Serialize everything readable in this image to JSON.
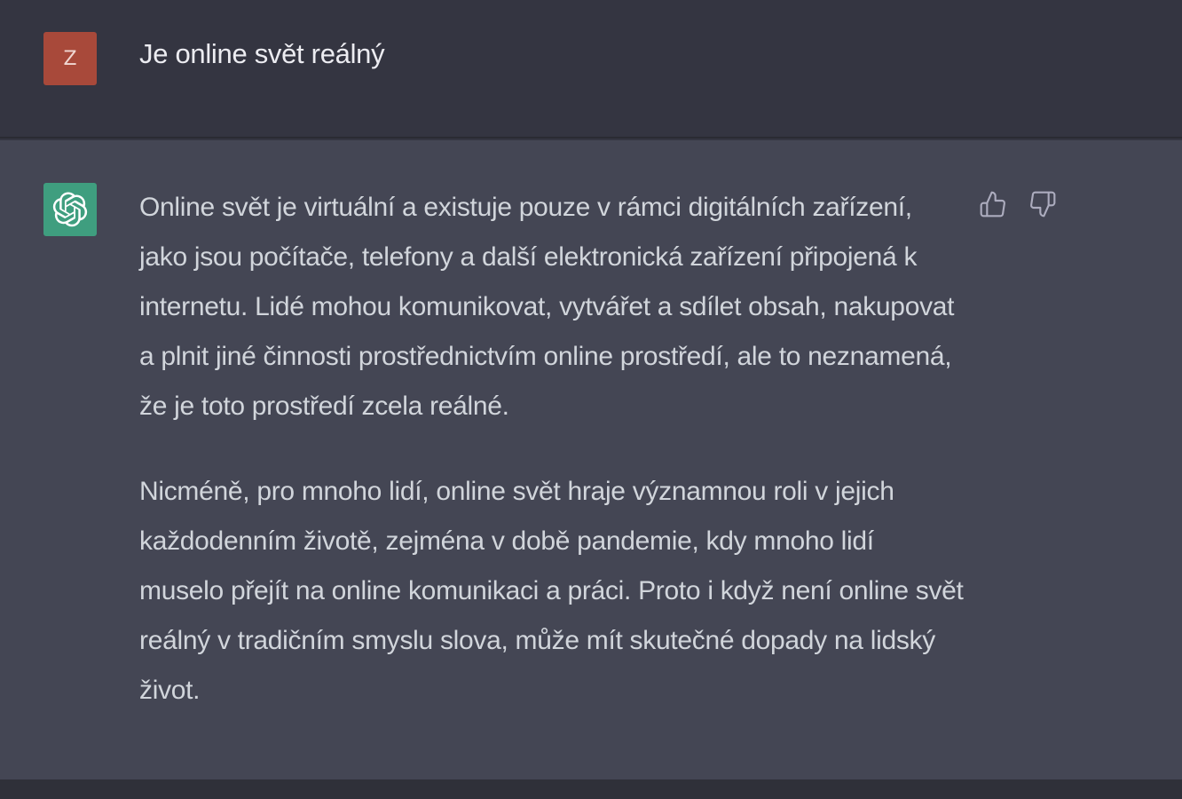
{
  "user_message": {
    "avatar_letter": "Z",
    "avatar_color": "#a8493a",
    "text": "Je online svět reálný"
  },
  "assistant_message": {
    "avatar_icon": "openai-logo-icon",
    "avatar_color": "#3f9e7f",
    "paragraphs": [
      "Online svět je virtuální a existuje pouze v rámci digitálních zařízení, jako jsou počítače, telefony a další elektronická zařízení připojená k internetu. Lidé mohou komunikovat, vytvářet a sdílet obsah, nakupovat a plnit jiné činnosti prostřednictvím online prostředí, ale to neznamená, že je toto prostředí zcela reálné.",
      "Nicméně, pro mnoho lidí, online svět hraje významnou roli v jejich každodenním životě, zejména v době pandemie, kdy mnoho lidí muselo přejít na online komunikaci a práci. Proto i když není online svět reálný v tradičním smyslu slova, může mít skutečné dopady na lidský život."
    ],
    "feedback": {
      "thumbs_up_icon": "thumbs-up-icon",
      "thumbs_down_icon": "thumbs-down-icon"
    }
  },
  "colors": {
    "background_user": "#343541",
    "background_assistant": "#444654",
    "text_primary": "#ececf1",
    "text_secondary": "#d1d5db"
  }
}
